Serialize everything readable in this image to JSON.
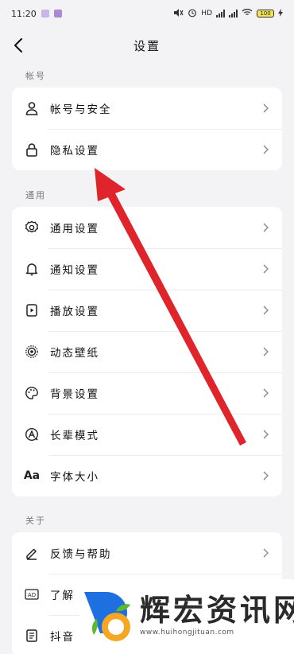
{
  "status_bar": {
    "time": "11:20",
    "network_label": "HD",
    "battery": "100"
  },
  "header": {
    "title": "设置"
  },
  "sections": [
    {
      "label": "帐号",
      "items": [
        {
          "label": "帐号与安全",
          "icon": "user-icon"
        },
        {
          "label": "隐私设置",
          "icon": "lock-icon"
        }
      ]
    },
    {
      "label": "通用",
      "items": [
        {
          "label": "通用设置",
          "icon": "gear-icon"
        },
        {
          "label": "通知设置",
          "icon": "bell-icon"
        },
        {
          "label": "播放设置",
          "icon": "play-settings-icon"
        },
        {
          "label": "动态壁纸",
          "icon": "live-wallpaper-icon"
        },
        {
          "label": "背景设置",
          "icon": "palette-icon"
        },
        {
          "label": "长辈模式",
          "icon": "elder-mode-icon"
        },
        {
          "label": "字体大小",
          "icon": "font-size-icon",
          "icon_text": "Aa"
        }
      ]
    },
    {
      "label": "关于",
      "items": [
        {
          "label": "反馈与帮助",
          "icon": "edit-icon"
        },
        {
          "label": "了解",
          "icon": "ad-icon",
          "icon_text": "AD"
        },
        {
          "label": "抖音",
          "icon": "document-icon"
        }
      ]
    }
  ],
  "watermark": {
    "text": "辉宏资讯网",
    "url": "www.huihongjituan.com"
  },
  "colors": {
    "background": "#f3f3f5",
    "card": "#ffffff",
    "annotation_arrow": "#e0242b"
  }
}
